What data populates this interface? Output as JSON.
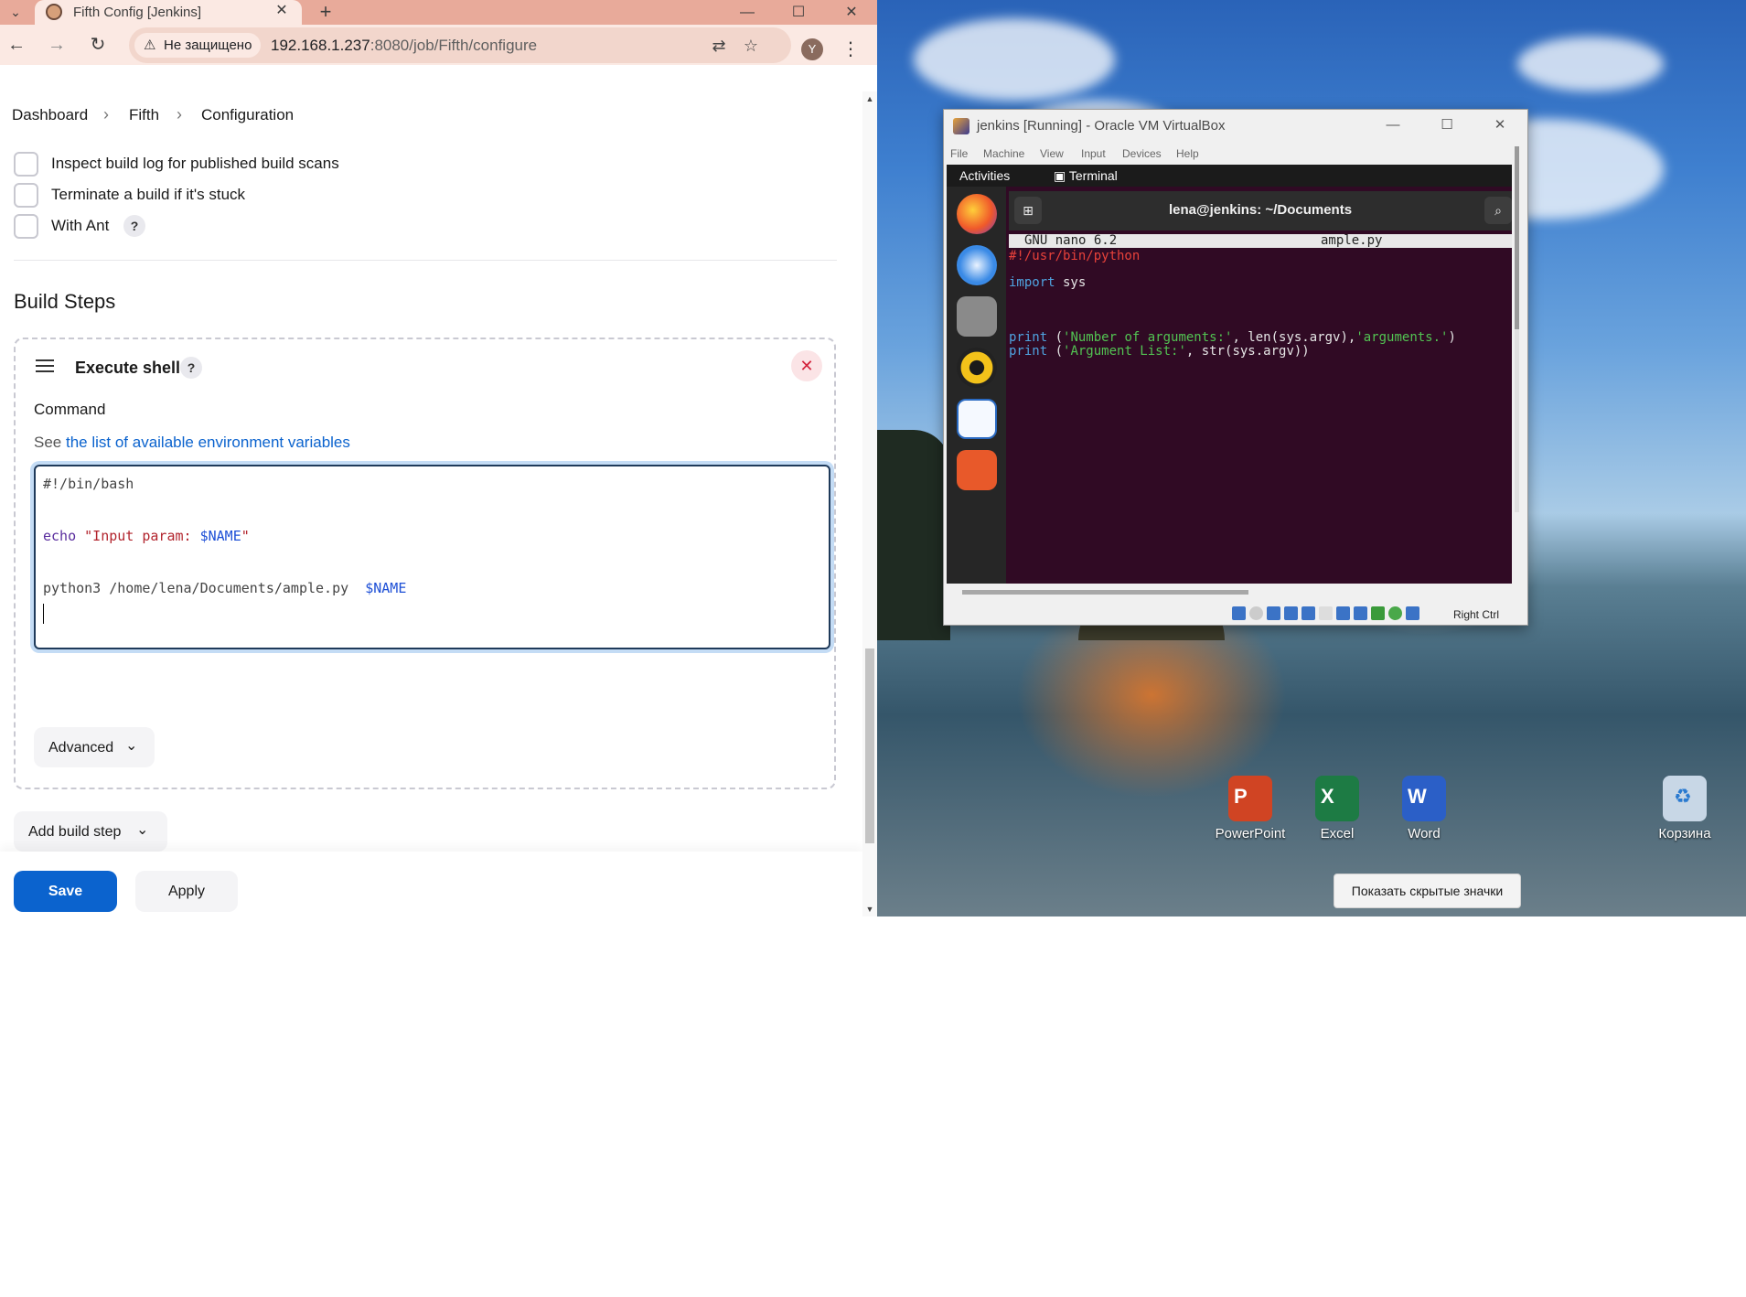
{
  "browser": {
    "tab_title": "Fifth Config [Jenkins]",
    "security_label": "Не защищено",
    "url_host": "192.168.1.237",
    "url_path": ":8080/job/Fifth/configure",
    "profile_initial": "Y"
  },
  "breadcrumb": {
    "items": [
      "Dashboard",
      "Fifth",
      "Configuration"
    ]
  },
  "options": [
    {
      "label": "Inspect build log for published build scans"
    },
    {
      "label": "Terminate a build if it's stuck"
    },
    {
      "label": "With Ant"
    }
  ],
  "build_steps": {
    "section_title": "Build Steps",
    "step_title": "Execute shell",
    "field_label": "Command",
    "hint_prefix": "See",
    "hint_link": "the list of available environment variables",
    "code": {
      "shebang": "#!/bin/bash",
      "echo_cmd": "echo",
      "echo_str_open": "\"Input param: ",
      "echo_var": "$NAME",
      "echo_str_close": "\"",
      "python_cmd": "python3 /home/lena/Documents/ample.py  ",
      "python_var": "$NAME"
    },
    "advanced_label": "Advanced",
    "add_step_label": "Add build step"
  },
  "actions": {
    "save_label": "Save",
    "apply_label": "Apply"
  },
  "desktop": {
    "icons": [
      {
        "name": "PowerPoint",
        "letter": "P",
        "color": "#d04423"
      },
      {
        "name": "Excel",
        "letter": "X",
        "color": "#1d7b44"
      },
      {
        "name": "Word",
        "letter": "W",
        "color": "#2b5fc7"
      },
      {
        "name": "Корзина",
        "letter": "♻",
        "color": "#c8d7e6"
      }
    ],
    "tooltip": "Показать скрытые значки"
  },
  "vbox": {
    "title": "jenkins [Running] - Oracle VM VirtualBox",
    "menu": [
      "File",
      "Machine",
      "View",
      "Input",
      "Devices",
      "Help"
    ],
    "activities": "Activities",
    "terminal_label": "Terminal",
    "terminal_title": "lena@jenkins: ~/Documents",
    "nano_version": "GNU nano 6.2",
    "nano_file": "ample.py",
    "py": {
      "shebang": "#!/usr/bin/python",
      "import_kw": "import",
      "import_mod": " sys",
      "print_kw": "print",
      "line1_a": " (",
      "line1_str": "'Number of arguments:'",
      "line1_b": ", len(sys.argv),",
      "line1_str2": "'arguments.'",
      "line1_c": ")",
      "line2_a": " (",
      "line2_str": "'Argument List:'",
      "line2_b": ", str(sys.argv))"
    },
    "host_key": "Right Ctrl"
  }
}
